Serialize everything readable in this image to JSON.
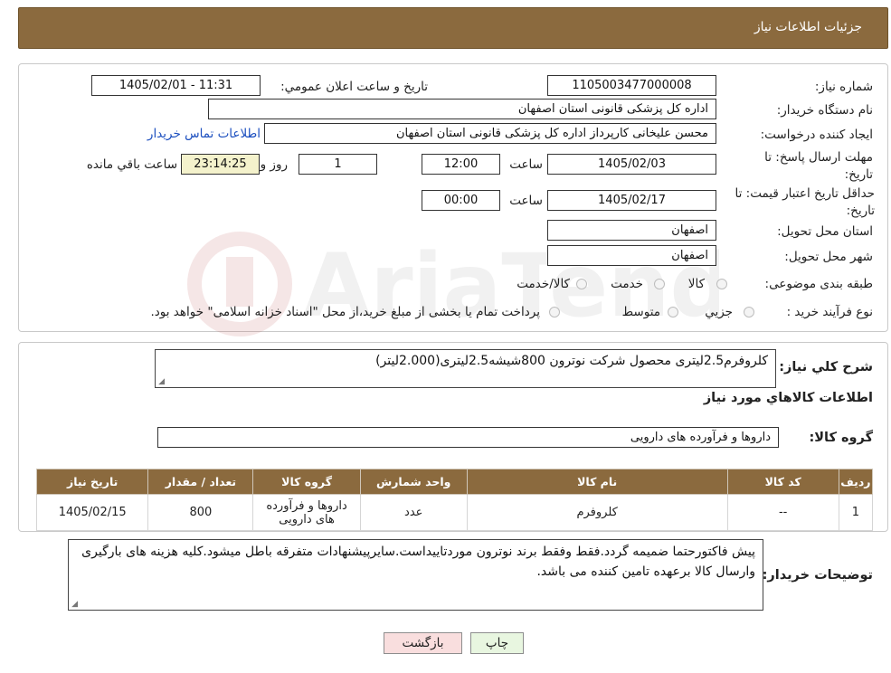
{
  "header": {
    "title": "جزئيات اطلاعات نياز"
  },
  "fields": {
    "need_number_label": "شماره نياز:",
    "need_number": "1105003477000008",
    "announce_label": "تاريخ و ساعت اعلان عمومي:",
    "announce_value": "1405/02/01 - 11:31",
    "buyer_org_label": "نام دستگاه خريدار:",
    "buyer_org": "اداره کل پزشکی قانونی استان اصفهان",
    "requester_label": "ايجاد کننده درخواست:",
    "requester": "محسن عليخانی کارپرداز اداره کل پزشکی قانونی استان اصفهان",
    "buyer_contact_link": "اطلاعات تماس خريدار",
    "deadline_label": "مهلت ارسال پاسخ: تا تاريخ:",
    "deadline_date": "1405/02/03",
    "time_label": "ساعت",
    "deadline_time": "12:00",
    "days_value": "1",
    "days_label": "روز و",
    "remaining_value": "23:14:25",
    "remaining_label": "ساعت باقي مانده",
    "validity_label": "حداقل تاريخ اعتبار قيمت: تا تاريخ:",
    "validity_date": "1405/02/17",
    "validity_time": "00:00",
    "province_label": "استان محل تحويل:",
    "province": "اصفهان",
    "city_label": "شهر محل تحويل:",
    "city": "اصفهان",
    "category_label": "طبقه بندی موضوعی:",
    "category_options": [
      "کالا",
      "خدمت",
      "کالا/خدمت"
    ],
    "process_label": "نوع فرآيند خريد :",
    "process_options": [
      "جزيي",
      "متوسط"
    ],
    "process_note": "پرداخت تمام يا بخشی از مبلغ خريد،از محل \"اسناد خزانه اسلامی\" خواهد بود."
  },
  "description": {
    "label": "شرح كلي نياز:",
    "text": "کلروفرم2.5ليتری محصول شرکت نوترون  800شيشه2.5ليتری(2.000ليتر)"
  },
  "goods_info": {
    "title": "اطلاعات کالاهاي مورد نياز",
    "group_label": "گروه کالا:",
    "group_value": "داروها و فرآورده های دارويی"
  },
  "table": {
    "headers": [
      "رديف",
      "کد کالا",
      "نام کالا",
      "واحد شمارش",
      "گروه کالا",
      "تعداد / مقدار",
      "تاريخ نياز"
    ],
    "rows": [
      [
        "1",
        "--",
        "کلروفرم",
        "عدد",
        "داروها و فرآورده های دارويی",
        "800",
        "1405/02/15"
      ]
    ]
  },
  "buyer_notes": {
    "label": "توضيحات خريدار:",
    "text": "پيش فاکتورحتما ضميمه گردد.فقط وفقط برند نوترون موردتاييداست.سايرپيشنهادات متفرقه باطل ميشود.کليه هزينه های بارگيری وارسال کالا برعهده تامين کننده می باشد."
  },
  "buttons": {
    "print": "چاپ",
    "back": "بازگشت"
  },
  "watermark_text": "AriaTender.neT",
  "colors": {
    "header_bg": "#8b6a3e",
    "link": "#1c4fbf",
    "yellow_field": "#f4f2cc",
    "back_button": "#f9dede",
    "print_button": "#e8f6e0"
  }
}
